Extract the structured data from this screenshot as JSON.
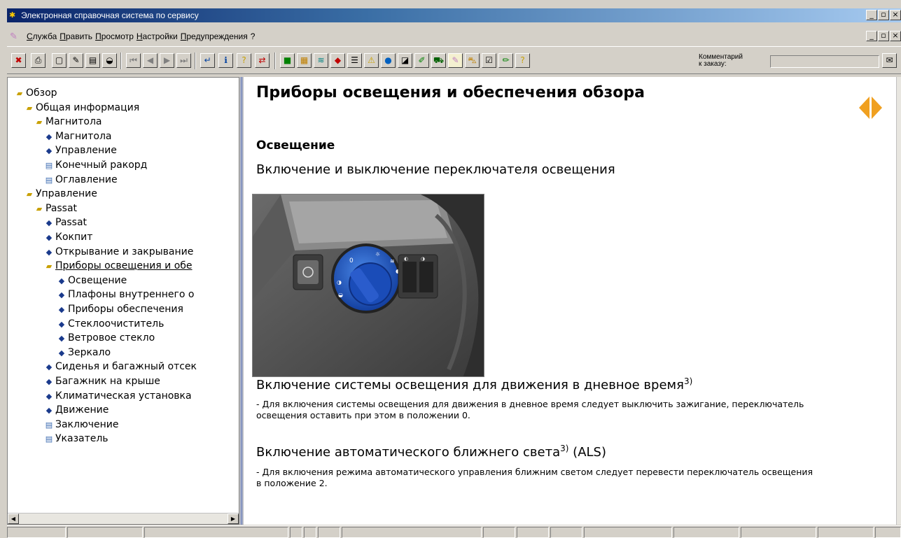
{
  "window": {
    "title": "Электронная справочная система по сервису",
    "minimize": "_",
    "maximize": "▫",
    "close": "×"
  },
  "menu": {
    "items": [
      "Служба",
      "Править",
      "Просмотр",
      "Настройки",
      "Предупреждения",
      "?"
    ]
  },
  "toolbar": {
    "comment_label_line1": "Комментарий",
    "comment_label_line2": "к заказу:",
    "comment_value": ""
  },
  "tree": {
    "items": [
      {
        "label": "Обзор",
        "icon": "folder-open-icon",
        "level": 0
      },
      {
        "label": "Общая информация",
        "icon": "folder-open-icon",
        "level": 1
      },
      {
        "label": "Магнитола",
        "icon": "folder-open-icon",
        "level": 2
      },
      {
        "label": "Магнитола",
        "icon": "book-icon",
        "level": 3
      },
      {
        "label": "Управление",
        "icon": "book-icon",
        "level": 3
      },
      {
        "label": "Конечный ракорд",
        "icon": "document-icon",
        "level": 3
      },
      {
        "label": "Оглавление",
        "icon": "document-icon",
        "level": 3
      },
      {
        "label": "Управление",
        "icon": "folder-open-icon",
        "level": 1
      },
      {
        "label": "Passat",
        "icon": "folder-open-icon",
        "level": 2
      },
      {
        "label": "Passat",
        "icon": "book-icon",
        "level": 3
      },
      {
        "label": "Кокпит",
        "icon": "book-icon",
        "level": 3
      },
      {
        "label": "Открывание и закрывание",
        "icon": "book-icon",
        "level": 3
      },
      {
        "label": "Приборы освещения и обе",
        "icon": "folder-open-icon",
        "level": 3,
        "selected": true
      },
      {
        "label": "Освещение",
        "icon": "book-icon",
        "level": 4
      },
      {
        "label": "Плафоны внутреннего о",
        "icon": "book-icon",
        "level": 4
      },
      {
        "label": "Приборы обеспечения",
        "icon": "book-icon",
        "level": 4
      },
      {
        "label": "Стеклоочиститель",
        "icon": "book-icon",
        "level": 4
      },
      {
        "label": "Ветровое стекло",
        "icon": "book-icon",
        "level": 4
      },
      {
        "label": "Зеркало",
        "icon": "book-icon",
        "level": 4
      },
      {
        "label": "Сиденья и багажный отсек",
        "icon": "book-icon",
        "level": 3
      },
      {
        "label": "Багажник на крыше",
        "icon": "book-icon",
        "level": 3
      },
      {
        "label": "Климатическая установка",
        "icon": "book-icon",
        "level": 3
      },
      {
        "label": "Движение",
        "icon": "book-icon",
        "level": 3
      },
      {
        "label": "Заключение",
        "icon": "document-icon",
        "level": 3
      },
      {
        "label": "Указатель",
        "icon": "document-icon",
        "level": 3
      }
    ]
  },
  "content": {
    "title": "Приборы освещения и обеспечения обзора",
    "section": "Освещение",
    "subtitle": "Включение и выключение переключателя освещения",
    "block1_title": "Включение системы освещения для движения в дневное время",
    "block1_sup": "3)",
    "block1_text": "- Для включения системы освещения для движения в дневное время следует выключить зажигание, переключатель освещения оставить при этом в положении 0.",
    "block2_title": "Включение автоматического ближнего света",
    "block2_sup": "3)",
    "block2_suffix": "(ALS)",
    "block2_text": "- Для включения режима автоматического управления ближним светом следует перевести переключатель освещения в положение 2."
  },
  "colors": {
    "accent_arrow": "#f0a020",
    "title_bar": "#0a246a",
    "switch_blue": "#1e5ac8"
  }
}
